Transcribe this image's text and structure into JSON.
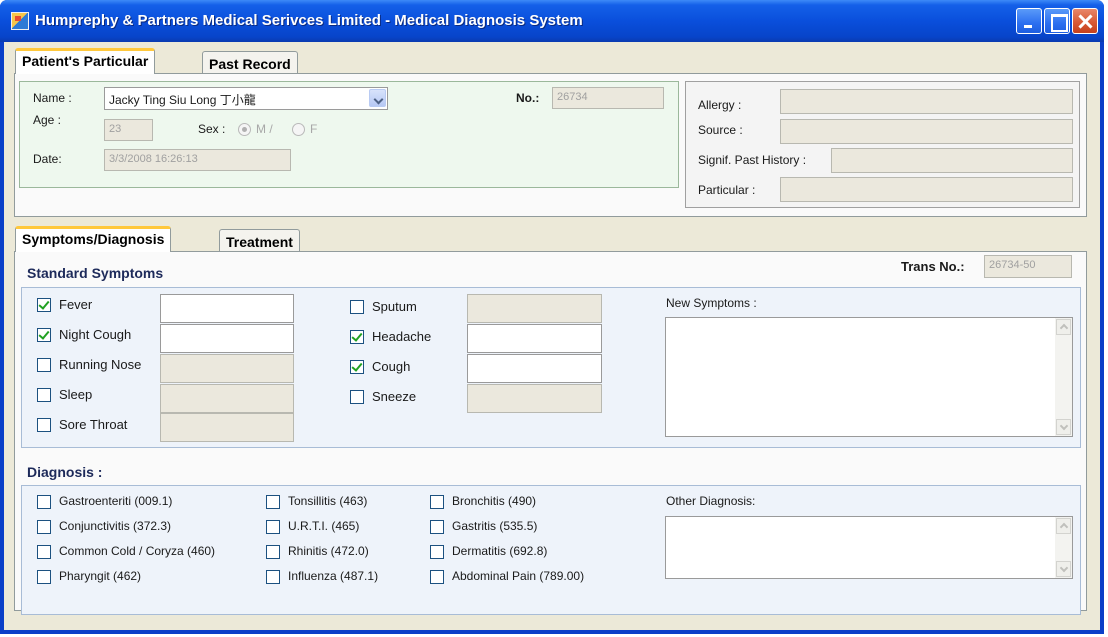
{
  "window": {
    "title": "Humprephy & Partners Medical Serivces Limited - Medical Diagnosis System"
  },
  "patient_tabs": [
    "Patient's Particular",
    "Past Record"
  ],
  "patient": {
    "name_label": "Name :",
    "name_value": "Jacky Ting Siu Long  丁小龍",
    "age_label": "Age :",
    "age_value": "23",
    "sex_label": "Sex :",
    "sex_m": "M /",
    "sex_f": "F",
    "sex_selected": "M",
    "date_label": "Date:",
    "date_value": "3/3/2008 16:26:13",
    "no_label": "No.:",
    "no_value": "26734"
  },
  "history": {
    "allergy_label": "Allergy :",
    "source_label": "Source :",
    "signif_label": "Signif. Past History :",
    "particular_label": "Particular :"
  },
  "diag_tabs": [
    "Symptoms/Diagnosis",
    "Treatment"
  ],
  "trans": {
    "label": "Trans No.:",
    "value": "26734-50"
  },
  "standard_symptoms": {
    "heading": "Standard Symptoms",
    "left": [
      {
        "label": "Fever",
        "checked": true
      },
      {
        "label": "Night Cough",
        "checked": true
      },
      {
        "label": "Running Nose",
        "checked": false
      },
      {
        "label": "Sleep",
        "checked": false
      },
      {
        "label": "Sore Throat",
        "checked": false
      }
    ],
    "right": [
      {
        "label": "Sputum",
        "checked": false
      },
      {
        "label": "Headache",
        "checked": true
      },
      {
        "label": "Cough",
        "checked": true
      },
      {
        "label": "Sneeze",
        "checked": false
      }
    ],
    "new_symptoms_label": "New Symptoms :"
  },
  "diagnosis": {
    "heading": "Diagnosis :",
    "col1": [
      "Gastroenteriti (009.1)",
      "Conjunctivitis (372.3)",
      "Common Cold / Coryza (460)",
      "Pharyngit (462)"
    ],
    "col2": [
      "Tonsillitis (463)",
      "U.R.T.I. (465)",
      "Rhinitis (472.0)",
      "Influenza (487.1)"
    ],
    "col3": [
      "Bronchitis (490)",
      "Gastritis (535.5)",
      "Dermatitis (692.8)",
      "Abdominal Pain (789.00)"
    ],
    "other_label": "Other Diagnosis:"
  },
  "colors": {
    "title_bar": "#0a4fdc",
    "window_bg": "#ece9d8",
    "tab_highlight": "#ffc83c",
    "check_mark": "#21a121"
  }
}
